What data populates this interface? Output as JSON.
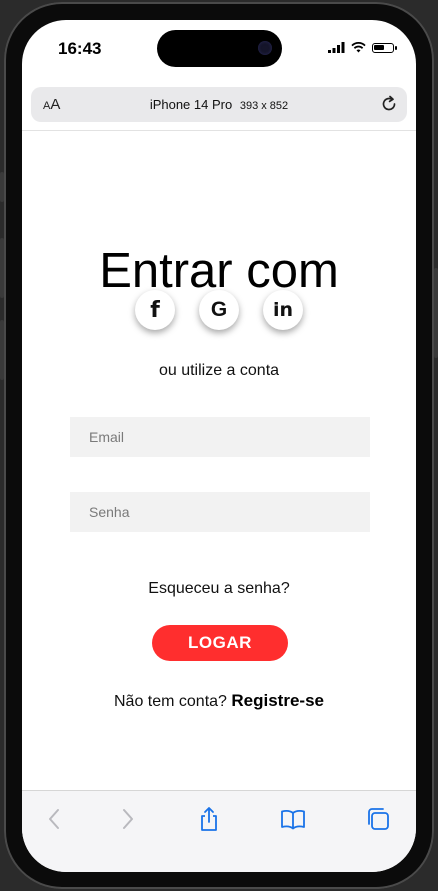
{
  "status_bar": {
    "time": "16:43",
    "battery_level": 0.6
  },
  "browser": {
    "text_size_label_small": "A",
    "text_size_label_large": "A",
    "device_name": "iPhone 14 Pro",
    "device_dims": "393 x 852"
  },
  "login": {
    "title": "Entrar com",
    "social": {
      "facebook": "f",
      "google": "G",
      "linkedin": "in"
    },
    "or_text": "ou utilize a conta",
    "email_placeholder": "Email",
    "password_placeholder": "Senha",
    "forgot_text": "Esqueceu a senha?",
    "login_button": "LOGAR",
    "no_account_text": "Não tem conta?",
    "register_link": "Registre-se"
  },
  "colors": {
    "accent": "#ff2e2e",
    "ios_blue": "#1a73e8",
    "field_bg": "#f2f2f2"
  },
  "toolbar_icons": [
    "back-icon",
    "forward-icon",
    "share-icon",
    "bookmarks-icon",
    "tabs-icon"
  ]
}
